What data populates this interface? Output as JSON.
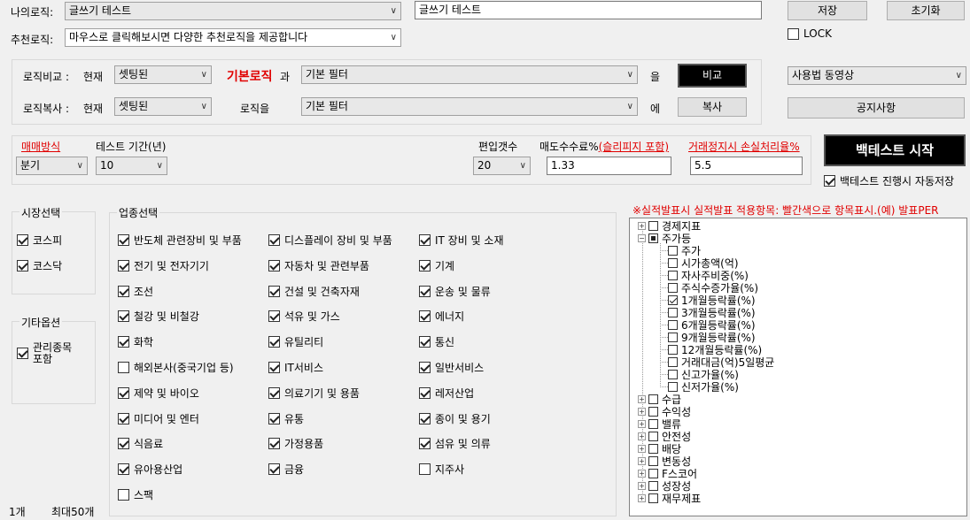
{
  "top": {
    "my_logic_label": "나의로직:",
    "my_logic_value": "글쓰기 테스트",
    "my_logic_text": "글쓰기 테스트",
    "rec_logic_label": "추천로직:",
    "rec_logic_value": "마우스로 클릭해보시면 다양한 추천로직을 제공합니다",
    "save": "저장",
    "reset": "초기화",
    "lock": "LOCK"
  },
  "compare": {
    "label": "로직비교 :",
    "current": "현재",
    "select": "셋팅된",
    "basic_logic": "기본로직",
    "with": "과",
    "filter": "기본 필터",
    "eul": "을",
    "button": "비교"
  },
  "copy": {
    "label": "로직복사 :",
    "current": "현재",
    "select": "셋팅된",
    "logic_eul": "로직을",
    "filter": "기본 필터",
    "e": "에",
    "button": "복사"
  },
  "right": {
    "video": "사용법 동영상",
    "notice": "공지사항",
    "start": "백테스트 시작",
    "autosave": "백테스트 진행시 자동저장"
  },
  "params": {
    "trade_label": "매매방식",
    "trade_value": "분기",
    "period_label": "테스트 기간(년)",
    "period_value": "10",
    "count_label": "편입갯수",
    "count_value": "20",
    "fee_label": "매도수수료%",
    "slip_label": "(슬리피지 포함)",
    "fee_value": "1.33",
    "stop_label": "거래정지시 손실처리율%",
    "stop_value": "5.5"
  },
  "market": {
    "title": "시장선택",
    "items": [
      {
        "label": "코스피",
        "checked": true
      },
      {
        "label": "코스닥",
        "checked": true
      }
    ]
  },
  "other": {
    "title": "기타옵션",
    "item": "관리종목\n포함"
  },
  "sector": {
    "title": "업종선택",
    "items": [
      {
        "label": "반도체 관련장비 및 부품",
        "checked": true
      },
      {
        "label": "디스플레이 장비 및 부품",
        "checked": true
      },
      {
        "label": "IT 장비 및 소재",
        "checked": true
      },
      {
        "label": "전기 및 전자기기",
        "checked": true
      },
      {
        "label": "자동차 및 관련부품",
        "checked": true
      },
      {
        "label": "기계",
        "checked": true
      },
      {
        "label": "조선",
        "checked": true
      },
      {
        "label": "건설 및 건축자재",
        "checked": true
      },
      {
        "label": "운송 및 물류",
        "checked": true
      },
      {
        "label": "철강 및 비철강",
        "checked": true
      },
      {
        "label": "석유 및 가스",
        "checked": true
      },
      {
        "label": "에너지",
        "checked": true
      },
      {
        "label": "화학",
        "checked": true
      },
      {
        "label": "유틸리티",
        "checked": true
      },
      {
        "label": "통신",
        "checked": true
      },
      {
        "label": "해외본사(중국기업 등)",
        "checked": false
      },
      {
        "label": "IT서비스",
        "checked": true
      },
      {
        "label": "일반서비스",
        "checked": true
      },
      {
        "label": "제약 및 바이오",
        "checked": true
      },
      {
        "label": "의료기기 및 용품",
        "checked": true
      },
      {
        "label": "레저산업",
        "checked": true
      },
      {
        "label": "미디어 및 엔터",
        "checked": true
      },
      {
        "label": "유통",
        "checked": true
      },
      {
        "label": "종이 및 용기",
        "checked": true
      },
      {
        "label": "식음료",
        "checked": true
      },
      {
        "label": "가정용품",
        "checked": true
      },
      {
        "label": "섬유 및 의류",
        "checked": true
      },
      {
        "label": "유아용산업",
        "checked": true
      },
      {
        "label": "금융",
        "checked": true
      },
      {
        "label": "지주사",
        "checked": false
      },
      {
        "label": "스팩",
        "checked": false
      }
    ]
  },
  "notice_red": "※실적발표시 실적발표 적용항목: 빨간색으로 항목표시.(예) 발표PER",
  "tree": [
    {
      "label": "경제지표",
      "level": 0,
      "expander": "+",
      "state": "off"
    },
    {
      "label": "주가등",
      "level": 0,
      "expander": "-",
      "state": "part"
    },
    {
      "label": "주가",
      "level": 1,
      "state": "off"
    },
    {
      "label": "시가총액(억)",
      "level": 1,
      "state": "off"
    },
    {
      "label": "자사주비중(%)",
      "level": 1,
      "state": "off"
    },
    {
      "label": "주식수증가율(%)",
      "level": 1,
      "state": "off"
    },
    {
      "label": "1개월등락률(%)",
      "level": 1,
      "state": "on"
    },
    {
      "label": "3개월등락률(%)",
      "level": 1,
      "state": "off"
    },
    {
      "label": "6개월등락률(%)",
      "level": 1,
      "state": "off"
    },
    {
      "label": "9개월등락률(%)",
      "level": 1,
      "state": "off"
    },
    {
      "label": "12개월등락률(%)",
      "level": 1,
      "state": "off"
    },
    {
      "label": "거래대금(억)5일평균",
      "level": 1,
      "state": "off"
    },
    {
      "label": "신고가율(%)",
      "level": 1,
      "state": "off"
    },
    {
      "label": "신저가율(%)",
      "level": 1,
      "state": "off"
    },
    {
      "label": "수급",
      "level": 0,
      "expander": "+",
      "state": "off"
    },
    {
      "label": "수익성",
      "level": 0,
      "expander": "+",
      "state": "off"
    },
    {
      "label": "밸류",
      "level": 0,
      "expander": "+",
      "state": "off"
    },
    {
      "label": "안전성",
      "level": 0,
      "expander": "+",
      "state": "off"
    },
    {
      "label": "배당",
      "level": 0,
      "expander": "+",
      "state": "off"
    },
    {
      "label": "변동성",
      "level": 0,
      "expander": "+",
      "state": "off"
    },
    {
      "label": "F스코어",
      "level": 0,
      "expander": "+",
      "state": "off"
    },
    {
      "label": "성장성",
      "level": 0,
      "expander": "+",
      "state": "off"
    },
    {
      "label": "재무제표",
      "level": 0,
      "expander": "+",
      "state": "off"
    }
  ],
  "footer": {
    "count": "1개",
    "max": "최대50개"
  }
}
